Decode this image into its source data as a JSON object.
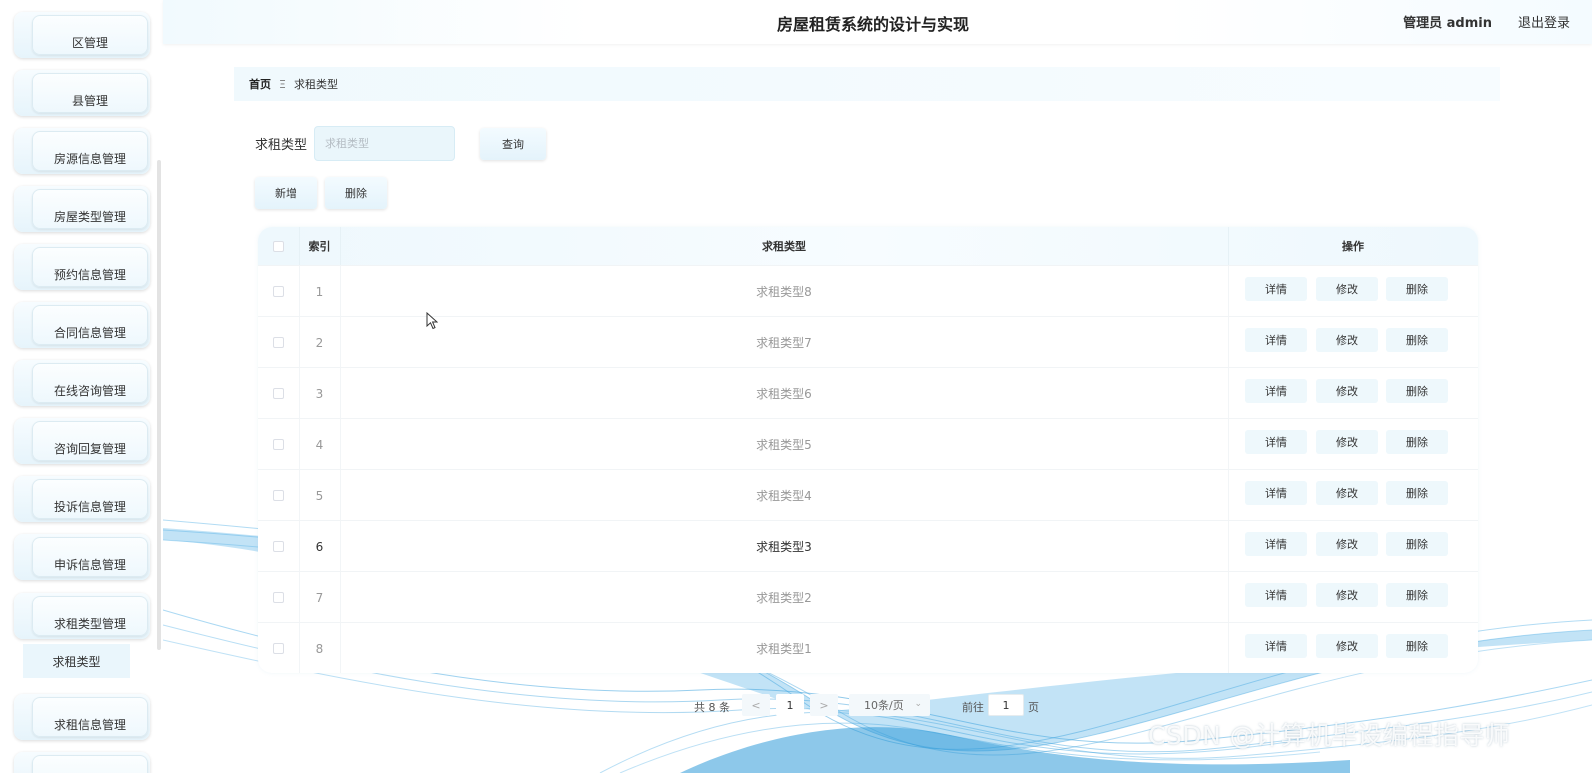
{
  "header": {
    "title": "房屋租赁系统的设计与实现",
    "user": "管理员 admin",
    "logout": "退出登录"
  },
  "sidebar": {
    "items": [
      {
        "label": "区管理"
      },
      {
        "label": "县管理"
      },
      {
        "label": "房源信息管理"
      },
      {
        "label": "房屋类型管理"
      },
      {
        "label": "预约信息管理"
      },
      {
        "label": "合同信息管理"
      },
      {
        "label": "在线咨询管理"
      },
      {
        "label": "咨询回复管理"
      },
      {
        "label": "投诉信息管理"
      },
      {
        "label": "申诉信息管理"
      },
      {
        "label": "求租类型管理"
      },
      {
        "label": "求租信息管理"
      }
    ],
    "submenu": {
      "label": "求租类型"
    }
  },
  "breadcrumb": {
    "home": "首页",
    "separator": "Ξ",
    "current": "求租类型"
  },
  "search": {
    "label": "求租类型",
    "placeholder": "求租类型",
    "query_label": "查询"
  },
  "actions": {
    "add_label": "新增",
    "delete_label": "删除"
  },
  "table": {
    "columns": {
      "index": "索引",
      "type": "求租类型",
      "ops": "操作"
    },
    "rows": [
      {
        "index": "1",
        "type": "求租类型8"
      },
      {
        "index": "2",
        "type": "求租类型7"
      },
      {
        "index": "3",
        "type": "求租类型6"
      },
      {
        "index": "4",
        "type": "求租类型5"
      },
      {
        "index": "5",
        "type": "求租类型4"
      },
      {
        "index": "6",
        "type": "求租类型3"
      },
      {
        "index": "7",
        "type": "求租类型2"
      },
      {
        "index": "8",
        "type": "求租类型1"
      }
    ],
    "ops": {
      "detail": "详情",
      "edit": "修改",
      "delete": "删除"
    }
  },
  "pagination": {
    "total": "共 8 条",
    "prev": "<",
    "page": "1",
    "next": ">",
    "page_size": "10条/页",
    "goto_prefix": "前往",
    "goto_value": "1",
    "goto_suffix": "页"
  },
  "watermark": "CSDN @计算机毕设编程指导师",
  "colors": {
    "accent": "#e6f4fb",
    "wave": "#5bb6e6"
  }
}
